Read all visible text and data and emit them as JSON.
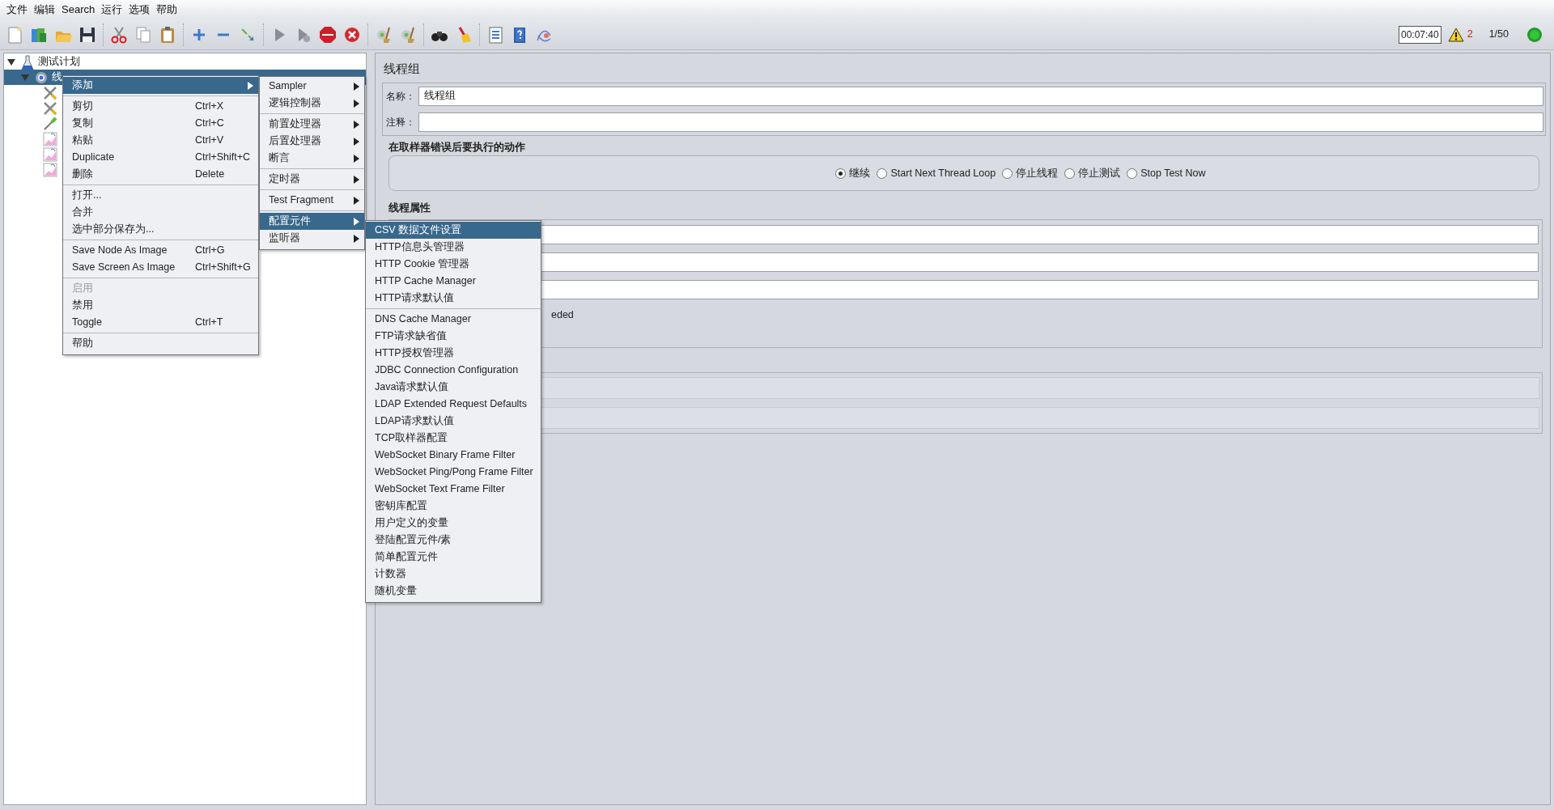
{
  "menu_bar": [
    {
      "label": "文件"
    },
    {
      "label": "编辑"
    },
    {
      "label": "Search"
    },
    {
      "label": "运行"
    },
    {
      "label": "选项"
    },
    {
      "label": "帮助"
    }
  ],
  "status": {
    "elapsed_time": "00:07:40",
    "warning_count": "2",
    "active_threads": "1/50"
  },
  "tree": [
    {
      "label": "测试计划",
      "expanded": true,
      "selected": false,
      "children": [
        {
          "label": "线",
          "expanded": true,
          "selected": true,
          "children": [
            {
              "kind": "tool",
              "selected": false
            },
            {
              "kind": "tool",
              "selected": false
            },
            {
              "kind": "pipette",
              "selected": false
            },
            {
              "kind": "graph",
              "selected": false
            },
            {
              "kind": "graph",
              "selected": false
            },
            {
              "kind": "graph",
              "selected": false
            }
          ]
        }
      ]
    }
  ],
  "context_menu": {
    "sections": [
      [
        {
          "label": "添加",
          "selected": true,
          "disabled": false,
          "submenu": true
        }
      ],
      [
        {
          "label": "剪切",
          "shortcut": "Ctrl+X",
          "selected": false,
          "disabled": false,
          "submenu": false
        },
        {
          "label": "复制",
          "shortcut": "Ctrl+C",
          "selected": false,
          "disabled": false,
          "submenu": false
        },
        {
          "label": "粘贴",
          "shortcut": "Ctrl+V",
          "selected": false,
          "disabled": false,
          "submenu": false
        },
        {
          "label": "Duplicate",
          "shortcut": "Ctrl+Shift+C",
          "selected": false,
          "disabled": false,
          "submenu": false
        },
        {
          "label": "删除",
          "shortcut": "Delete",
          "selected": false,
          "disabled": false,
          "submenu": false
        }
      ],
      [
        {
          "label": "打开...",
          "selected": false,
          "disabled": false,
          "submenu": false
        },
        {
          "label": "合并",
          "selected": false,
          "disabled": false,
          "submenu": false
        },
        {
          "label": "选中部分保存为...",
          "selected": false,
          "disabled": false,
          "submenu": false
        }
      ],
      [
        {
          "label": "Save Node As Image",
          "shortcut": "Ctrl+G",
          "selected": false,
          "disabled": false,
          "submenu": false
        },
        {
          "label": "Save Screen As Image",
          "shortcut": "Ctrl+Shift+G",
          "selected": false,
          "disabled": false,
          "submenu": false
        }
      ],
      [
        {
          "label": "启用",
          "selected": false,
          "disabled": true,
          "submenu": false
        },
        {
          "label": "禁用",
          "selected": false,
          "disabled": false,
          "submenu": false
        },
        {
          "label": "Toggle",
          "shortcut": "Ctrl+T",
          "selected": false,
          "disabled": false,
          "submenu": false
        }
      ],
      [
        {
          "label": "帮助",
          "selected": false,
          "disabled": false,
          "submenu": false
        }
      ]
    ]
  },
  "add_submenu": {
    "sections": [
      [
        {
          "label": "Sampler",
          "selected": false,
          "submenu": true
        },
        {
          "label": "逻辑控制器",
          "selected": false,
          "submenu": true
        }
      ],
      [
        {
          "label": "前置处理器",
          "selected": false,
          "submenu": true
        },
        {
          "label": "后置处理器",
          "selected": false,
          "submenu": true
        },
        {
          "label": "断言",
          "selected": false,
          "submenu": true
        }
      ],
      [
        {
          "label": "定时器",
          "selected": false,
          "submenu": true
        }
      ],
      [
        {
          "label": "Test Fragment",
          "selected": false,
          "submenu": true
        }
      ],
      [
        {
          "label": "配置元件",
          "selected": true,
          "submenu": true
        },
        {
          "label": "监听器",
          "selected": false,
          "submenu": true
        }
      ]
    ]
  },
  "config_submenu": {
    "sections": [
      [
        {
          "label": "CSV 数据文件设置",
          "selected": true
        },
        {
          "label": "HTTP信息头管理器",
          "selected": false
        },
        {
          "label": "HTTP Cookie 管理器",
          "selected": false
        },
        {
          "label": "HTTP Cache Manager",
          "selected": false
        },
        {
          "label": "HTTP请求默认值",
          "selected": false
        }
      ],
      [
        {
          "label": "DNS Cache Manager",
          "selected": false
        },
        {
          "label": "FTP请求缺省值",
          "selected": false
        },
        {
          "label": "HTTP授权管理器",
          "selected": false
        },
        {
          "label": "JDBC Connection Configuration",
          "selected": false
        },
        {
          "label": "Java请求默认值",
          "selected": false
        },
        {
          "label": "LDAP Extended Request Defaults",
          "selected": false
        },
        {
          "label": "LDAP请求默认值",
          "selected": false
        },
        {
          "label": "TCP取样器配置",
          "selected": false
        },
        {
          "label": "WebSocket Binary Frame Filter",
          "selected": false
        },
        {
          "label": "WebSocket Ping/Pong Frame Filter",
          "selected": false
        },
        {
          "label": "WebSocket Text Frame Filter",
          "selected": false
        },
        {
          "label": "密钥库配置",
          "selected": false
        },
        {
          "label": "用户定义的变量",
          "selected": false
        },
        {
          "label": "登陆配置元件/素",
          "selected": false
        },
        {
          "label": "简单配置元件",
          "selected": false
        },
        {
          "label": "计数器",
          "selected": false
        },
        {
          "label": "随机变量",
          "selected": false
        }
      ]
    ]
  },
  "panel": {
    "title": "线程组",
    "name_label": "名称：",
    "name_value": "线程组",
    "comment_label": "注释：",
    "on_error": {
      "title": "在取样器错误后要执行的动作",
      "options": [
        {
          "label": "继续",
          "selected": true
        },
        {
          "label": "Start Next Thread Loop",
          "selected": false
        },
        {
          "label": "停止线程",
          "selected": false
        },
        {
          "label": "停止测试",
          "selected": false
        },
        {
          "label": "Stop Test Now",
          "selected": false
        }
      ]
    },
    "thread_properties": {
      "title": "线程属性",
      "visible_text": "eded"
    }
  }
}
